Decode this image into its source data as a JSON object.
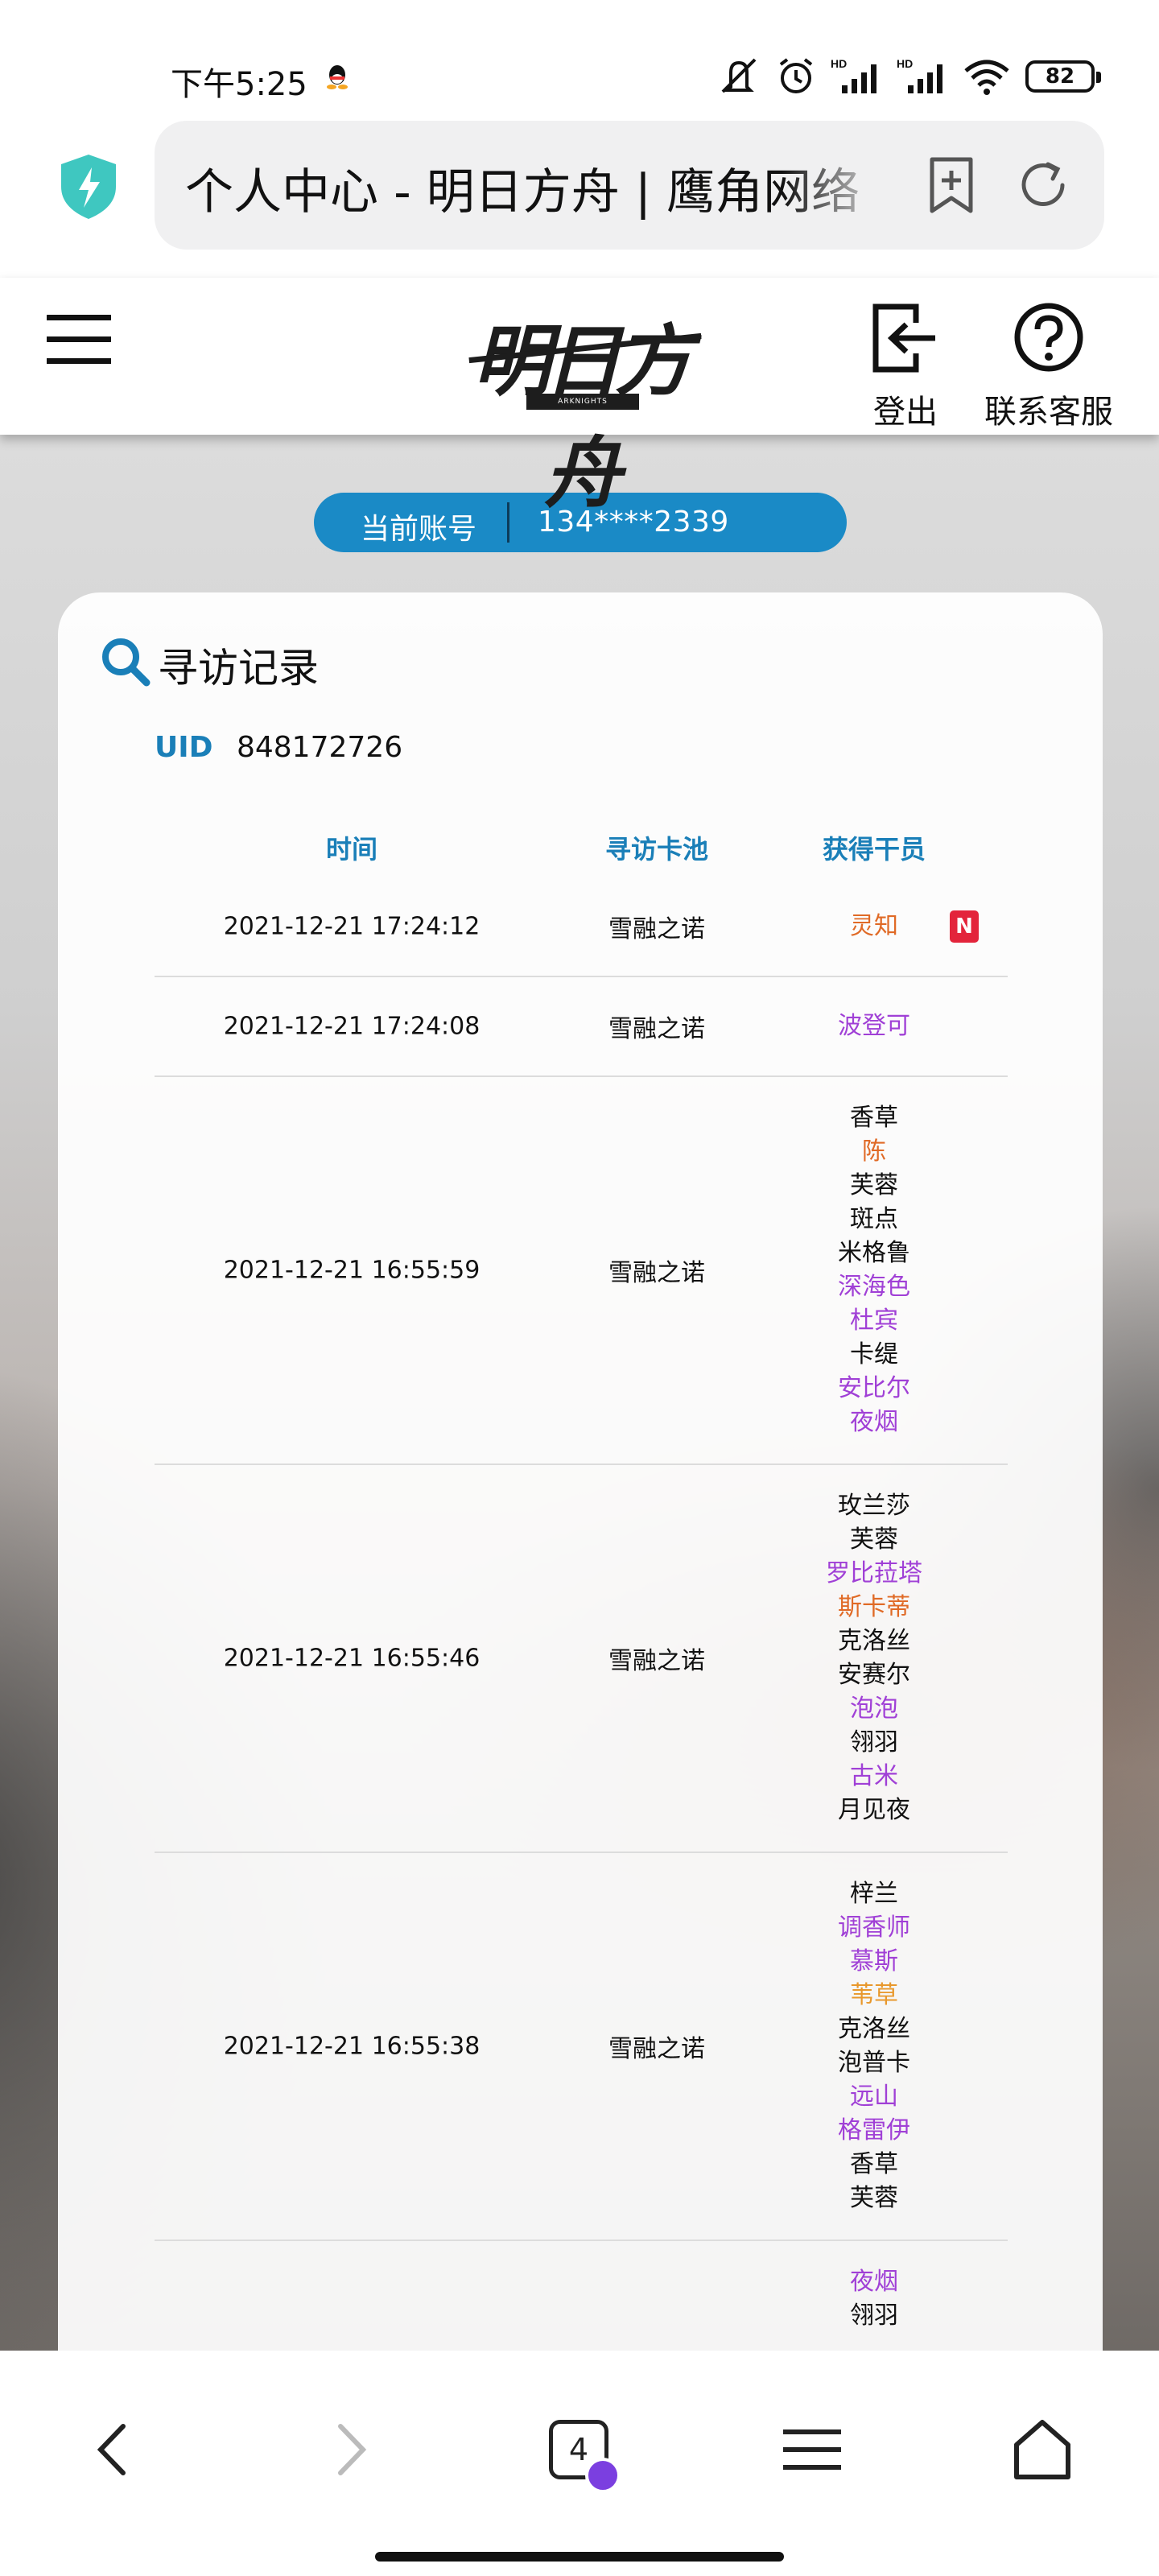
{
  "status_bar": {
    "time": "下午5:25",
    "battery": "82",
    "network_tag": "HD"
  },
  "browser": {
    "address_text": "个人中心 - 明日方舟 | 鹰角网络"
  },
  "header": {
    "logo_text": "明日方舟",
    "logo_sub": "ARKNIGHTS",
    "logout_label": "登出",
    "support_label": "联系客服"
  },
  "account": {
    "label": "当前账号",
    "value": "134****2339"
  },
  "card": {
    "title": "寻访记录",
    "uid_label": "UID",
    "uid_value": "848172726",
    "columns": {
      "time": "时间",
      "pool": "寻访卡池",
      "operators": "获得干员"
    },
    "records": [
      {
        "time": "2021-12-21 17:24:12",
        "pool": "雪融之诺",
        "new_badge": "N",
        "operators": [
          {
            "name": "灵知",
            "rarity": 6
          }
        ]
      },
      {
        "time": "2021-12-21 17:24:08",
        "pool": "雪融之诺",
        "operators": [
          {
            "name": "波登可",
            "rarity": 4
          }
        ]
      },
      {
        "time": "2021-12-21 16:55:59",
        "pool": "雪融之诺",
        "operators": [
          {
            "name": "香草",
            "rarity": 3
          },
          {
            "name": "陈",
            "rarity": 6
          },
          {
            "name": "芙蓉",
            "rarity": 3
          },
          {
            "name": "斑点",
            "rarity": 3
          },
          {
            "name": "米格鲁",
            "rarity": 3
          },
          {
            "name": "深海色",
            "rarity": 4
          },
          {
            "name": "杜宾",
            "rarity": 4
          },
          {
            "name": "卡缇",
            "rarity": 3
          },
          {
            "name": "安比尔",
            "rarity": 4
          },
          {
            "name": "夜烟",
            "rarity": 4
          }
        ]
      },
      {
        "time": "2021-12-21 16:55:46",
        "pool": "雪融之诺",
        "operators": [
          {
            "name": "玫兰莎",
            "rarity": 3
          },
          {
            "name": "芙蓉",
            "rarity": 3
          },
          {
            "name": "罗比菈塔",
            "rarity": 4
          },
          {
            "name": "斯卡蒂",
            "rarity": 6
          },
          {
            "name": "克洛丝",
            "rarity": 3
          },
          {
            "name": "安赛尔",
            "rarity": 3
          },
          {
            "name": "泡泡",
            "rarity": 4
          },
          {
            "name": "翎羽",
            "rarity": 3
          },
          {
            "name": "古米",
            "rarity": 4
          },
          {
            "name": "月见夜",
            "rarity": 3
          }
        ]
      },
      {
        "time": "2021-12-21 16:55:38",
        "pool": "雪融之诺",
        "operators": [
          {
            "name": "梓兰",
            "rarity": 3
          },
          {
            "name": "调香师",
            "rarity": 4
          },
          {
            "name": "慕斯",
            "rarity": 4
          },
          {
            "name": "苇草",
            "rarity": 5
          },
          {
            "name": "克洛丝",
            "rarity": 3
          },
          {
            "name": "泡普卡",
            "rarity": 3
          },
          {
            "name": "远山",
            "rarity": 4
          },
          {
            "name": "格雷伊",
            "rarity": 4
          },
          {
            "name": "香草",
            "rarity": 3
          },
          {
            "name": "芙蓉",
            "rarity": 3
          }
        ]
      },
      {
        "time": "",
        "pool": "",
        "operators": [
          {
            "name": "夜烟",
            "rarity": 4
          },
          {
            "name": "翎羽",
            "rarity": 3
          }
        ]
      }
    ]
  },
  "nav": {
    "tab_count": "4"
  },
  "colors": {
    "accent": "#1a8ac6",
    "rarity3": "#111111",
    "rarity4": "#a040d6",
    "rarity5": "#e8982c",
    "rarity6": "#e06a26",
    "new_badge": "#e3243b"
  }
}
